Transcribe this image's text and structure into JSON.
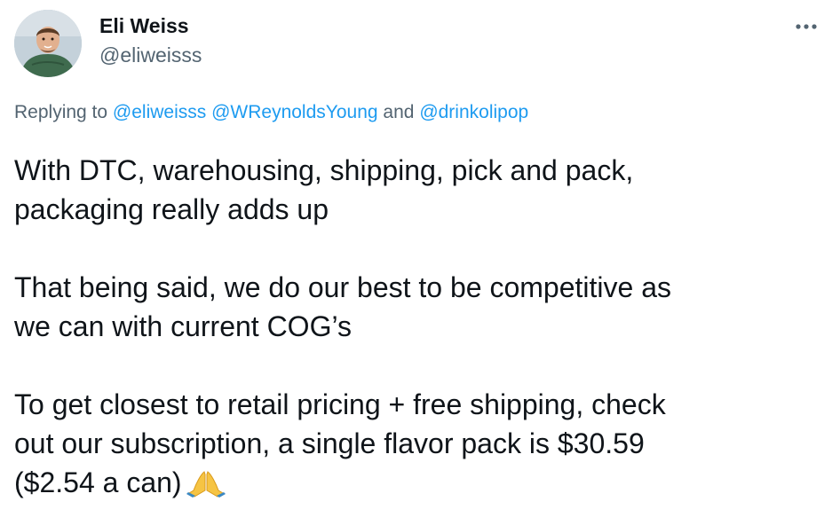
{
  "author": {
    "name": "Eli Weiss",
    "handle": "@eliweisss"
  },
  "more_icon": "more-horizontal-icon",
  "reply_context": {
    "prefix": "Replying to",
    "mentions": [
      "@eliweisss",
      "@WReynoldsYoung",
      "@drinkolipop"
    ],
    "joiner": "and"
  },
  "tweet": {
    "paragraphs": [
      "With DTC, warehousing, shipping, pick and pack,\npackaging really adds up",
      "That being said, we do our best to be competitive as\nwe can with current COG’s",
      "To get closest to retail pricing + free shipping, check\nout our subscription, a single flavor pack is $30.59\n($2.54 a can)"
    ],
    "emoji": "folded-hands-icon"
  },
  "colors": {
    "text": "#0f1419",
    "secondary": "#536471",
    "link": "#1d9bf0"
  }
}
